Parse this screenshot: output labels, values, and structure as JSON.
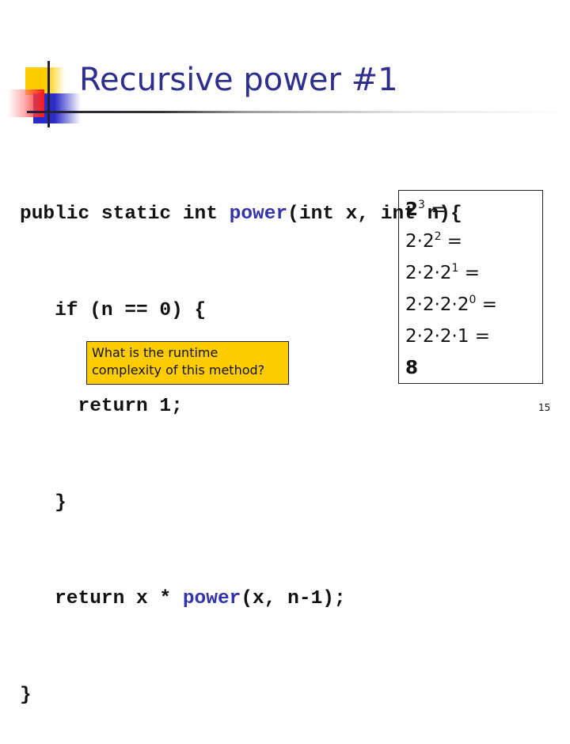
{
  "slide": {
    "title": "Recursive power #1",
    "page_number": "15"
  },
  "colors": {
    "title": "#2e2e8c",
    "function_name": "#3333aa",
    "callout_bg": "#ffcc00",
    "deco_yellow": "#ffcc00",
    "deco_red": "#ff1a1a",
    "deco_blue": "#2b2bc8"
  },
  "code": {
    "lines": [
      {
        "pre": "public static int ",
        "fn": "power",
        "post": "(int x, int n){"
      },
      {
        "pre": "   if (n == 0) {",
        "fn": "",
        "post": ""
      },
      {
        "pre": "     return 1;",
        "fn": "",
        "post": ""
      },
      {
        "pre": "   }",
        "fn": "",
        "post": ""
      },
      {
        "pre": "   return x * ",
        "fn": "power",
        "post": "(x, n-1);"
      },
      {
        "pre": "}",
        "fn": "",
        "post": ""
      }
    ]
  },
  "callout": {
    "line1": "What is the runtime",
    "line2": "complexity of this method?"
  },
  "expansion": {
    "lines": [
      {
        "base": "2",
        "exp": "3",
        "rest": " =",
        "bold": true
      },
      {
        "base": "2·2",
        "exp": "2",
        "rest": " =",
        "bold": false
      },
      {
        "base": "2·2·2",
        "exp": "1",
        "rest": " =",
        "bold": false
      },
      {
        "base": "2·2·2·2",
        "exp": "0",
        "rest": " =",
        "bold": false
      },
      {
        "base": "2·2·2·1",
        "exp": "",
        "rest": " =",
        "bold": false
      },
      {
        "base": "8",
        "exp": "",
        "rest": "",
        "bold": true
      }
    ]
  }
}
